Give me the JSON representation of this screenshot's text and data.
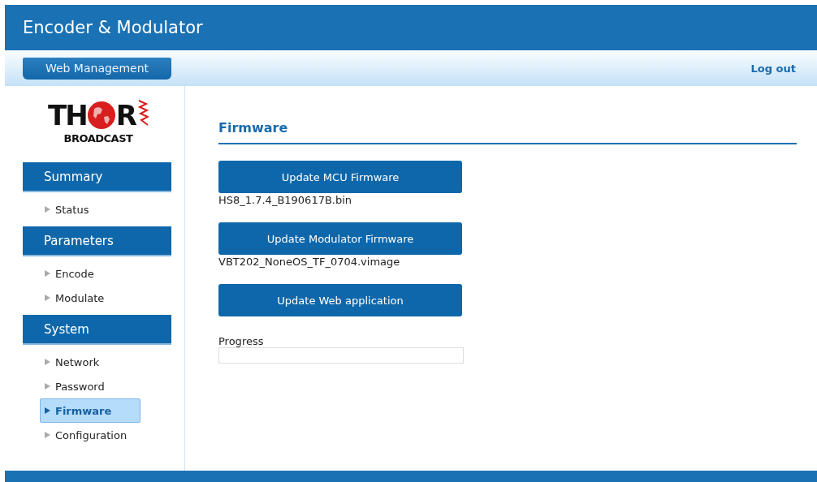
{
  "header": {
    "title": "Encoder & Modulator"
  },
  "subbar": {
    "tab": "Web Management",
    "logout": "Log out"
  },
  "logo": {
    "left": "TH",
    "right": "R",
    "tagline": "BROADCAST"
  },
  "sidebar": {
    "sections": [
      {
        "title": "Summary",
        "items": [
          {
            "label": "Status",
            "selected": false
          }
        ]
      },
      {
        "title": "Parameters",
        "items": [
          {
            "label": "Encode",
            "selected": false
          },
          {
            "label": "Modulate",
            "selected": false
          }
        ]
      },
      {
        "title": "System",
        "items": [
          {
            "label": "Network",
            "selected": false
          },
          {
            "label": "Password",
            "selected": false
          },
          {
            "label": "Firmware",
            "selected": true
          },
          {
            "label": "Configuration",
            "selected": false
          }
        ]
      }
    ]
  },
  "content": {
    "title": "Firmware",
    "updates": [
      {
        "button": "Update MCU Firmware",
        "file": "HS8_1.7.4_B190617B.bin"
      },
      {
        "button": "Update Modulator Firmware",
        "file": "VBT202_NoneOS_TF_0704.vimage"
      },
      {
        "button": "Update Web application"
      }
    ],
    "progress": {
      "label": "Progress"
    }
  }
}
